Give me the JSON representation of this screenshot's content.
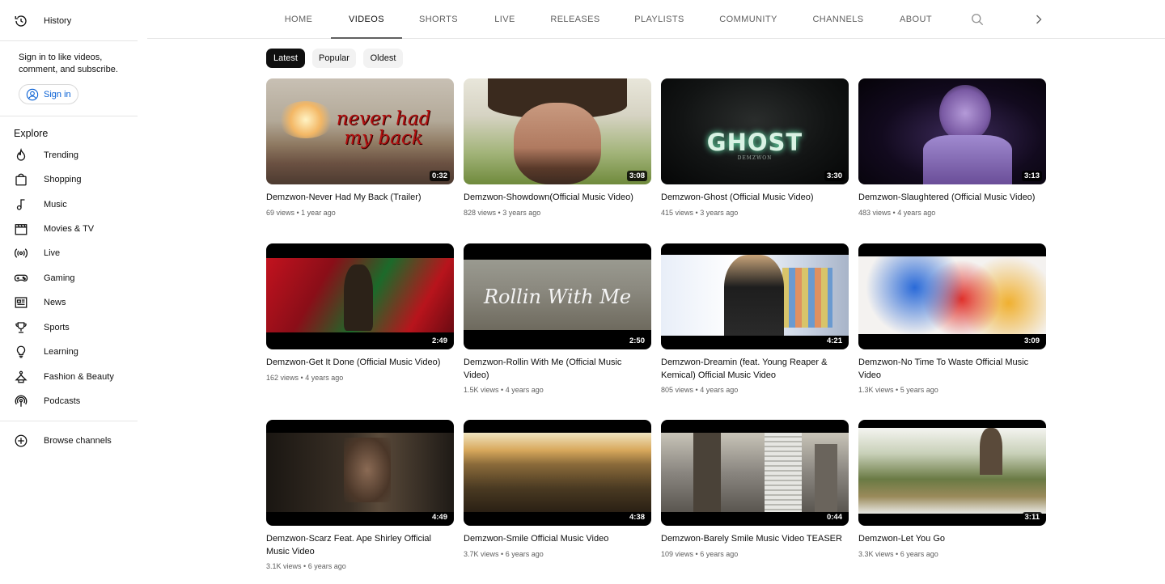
{
  "sidebar": {
    "history_label": "History",
    "signin_prompt": "Sign in to like videos, comment, and subscribe.",
    "signin_button": "Sign in",
    "explore_title": "Explore",
    "explore_items": [
      {
        "label": "Trending",
        "icon": "trending-icon"
      },
      {
        "label": "Shopping",
        "icon": "shopping-bag-icon"
      },
      {
        "label": "Music",
        "icon": "music-note-icon"
      },
      {
        "label": "Movies & TV",
        "icon": "clapperboard-icon"
      },
      {
        "label": "Live",
        "icon": "live-broadcast-icon"
      },
      {
        "label": "Gaming",
        "icon": "gamepad-icon"
      },
      {
        "label": "News",
        "icon": "newspaper-icon"
      },
      {
        "label": "Sports",
        "icon": "trophy-icon"
      },
      {
        "label": "Learning",
        "icon": "lightbulb-icon"
      },
      {
        "label": "Fashion & Beauty",
        "icon": "hanger-icon"
      },
      {
        "label": "Podcasts",
        "icon": "podcast-icon"
      }
    ],
    "browse_channels_label": "Browse channels"
  },
  "tabs": [
    "HOME",
    "VIDEOS",
    "SHORTS",
    "LIVE",
    "RELEASES",
    "PLAYLISTS",
    "COMMUNITY",
    "CHANNELS",
    "ABOUT"
  ],
  "active_tab": "VIDEOS",
  "chips": [
    "Latest",
    "Popular",
    "Oldest"
  ],
  "selected_chip": "Latest",
  "videos": [
    {
      "title": "Demzwon-Never Had My Back (Trailer)",
      "views": "69 views",
      "age": "1 year ago",
      "duration": "0:32",
      "overlay": "never had my back"
    },
    {
      "title": "Demzwon-Showdown(Official Music Video)",
      "views": "828 views",
      "age": "3 years ago",
      "duration": "3:08"
    },
    {
      "title": "Demzwon-Ghost (Official Music Video)",
      "views": "415 views",
      "age": "3 years ago",
      "duration": "3:30",
      "overlay": "GHOST",
      "overlay_sub": "DEMZWON"
    },
    {
      "title": "Demzwon-Slaughtered (Official Music Video)",
      "views": "483 views",
      "age": "4 years ago",
      "duration": "3:13"
    },
    {
      "title": "Demzwon-Get It Done (Official Music Video)",
      "views": "162 views",
      "age": "4 years ago",
      "duration": "2:49"
    },
    {
      "title": "Demzwon-Rollin With Me (Official Music Video)",
      "views": "1.5K views",
      "age": "4 years ago",
      "duration": "2:50",
      "overlay": "Rollin With Me"
    },
    {
      "title": "Demzwon-Dreamin (feat. Young Reaper & Kemical) Official Music Video",
      "views": "805 views",
      "age": "4 years ago",
      "duration": "4:21"
    },
    {
      "title": "Demzwon-No Time To Waste Official Music Video",
      "views": "1.3K views",
      "age": "5 years ago",
      "duration": "3:09"
    },
    {
      "title": "Demzwon-Scarz Feat. Ape Shirley Official Music Video",
      "views": "3.1K views",
      "age": "6 years ago",
      "duration": "4:49"
    },
    {
      "title": "Demzwon-Smile Official Music Video",
      "views": "3.7K views",
      "age": "6 years ago",
      "duration": "4:38"
    },
    {
      "title": "Demzwon-Barely Smile Music Video TEASER",
      "views": "109 views",
      "age": "6 years ago",
      "duration": "0:44"
    },
    {
      "title": "Demzwon-Let You Go",
      "views": "3.3K views",
      "age": "6 years ago",
      "duration": "3:11"
    }
  ]
}
